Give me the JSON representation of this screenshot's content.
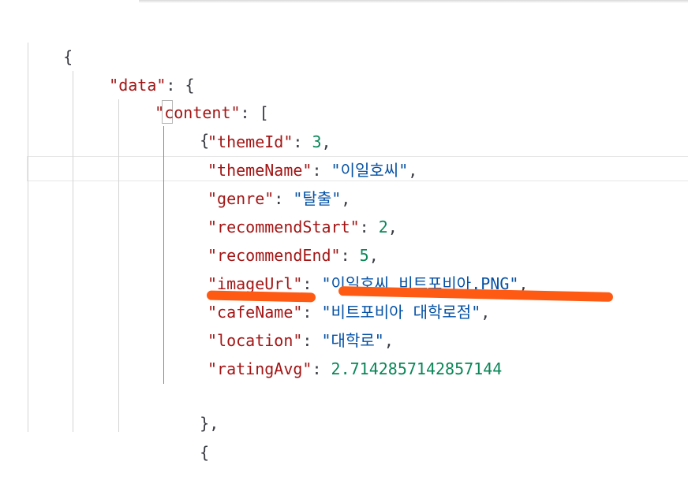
{
  "json_view": {
    "root_open": "{",
    "data_key": "\"data\"",
    "content_key": "\"content\"",
    "array_open": "[",
    "object_open": "{",
    "object_close": "}",
    "fields": [
      {
        "key": "\"themeId\"",
        "value": "3",
        "kind": "number"
      },
      {
        "key": "\"themeName\"",
        "value": "\"이일호씨\"",
        "kind": "string"
      },
      {
        "key": "\"genre\"",
        "value": "\"탈출\"",
        "kind": "string"
      },
      {
        "key": "\"recommendStart\"",
        "value": "2",
        "kind": "number"
      },
      {
        "key": "\"recommendEnd\"",
        "value": "5",
        "kind": "number"
      },
      {
        "key": "\"imageUrl\"",
        "value": "\"이일호씨_비트포비아.PNG\"",
        "kind": "string"
      },
      {
        "key": "\"cafeName\"",
        "value": "\"비트포비아 대학로점\"",
        "kind": "string"
      },
      {
        "key": "\"location\"",
        "value": "\"대학로\"",
        "kind": "string"
      },
      {
        "key": "\"ratingAvg\"",
        "value": "2.7142857142857144",
        "kind": "number"
      }
    ]
  },
  "colors": {
    "key": "#a31515",
    "string": "#0451a5",
    "number": "#098658",
    "punctuation": "#383a42",
    "annotation": "#ff5a14"
  }
}
